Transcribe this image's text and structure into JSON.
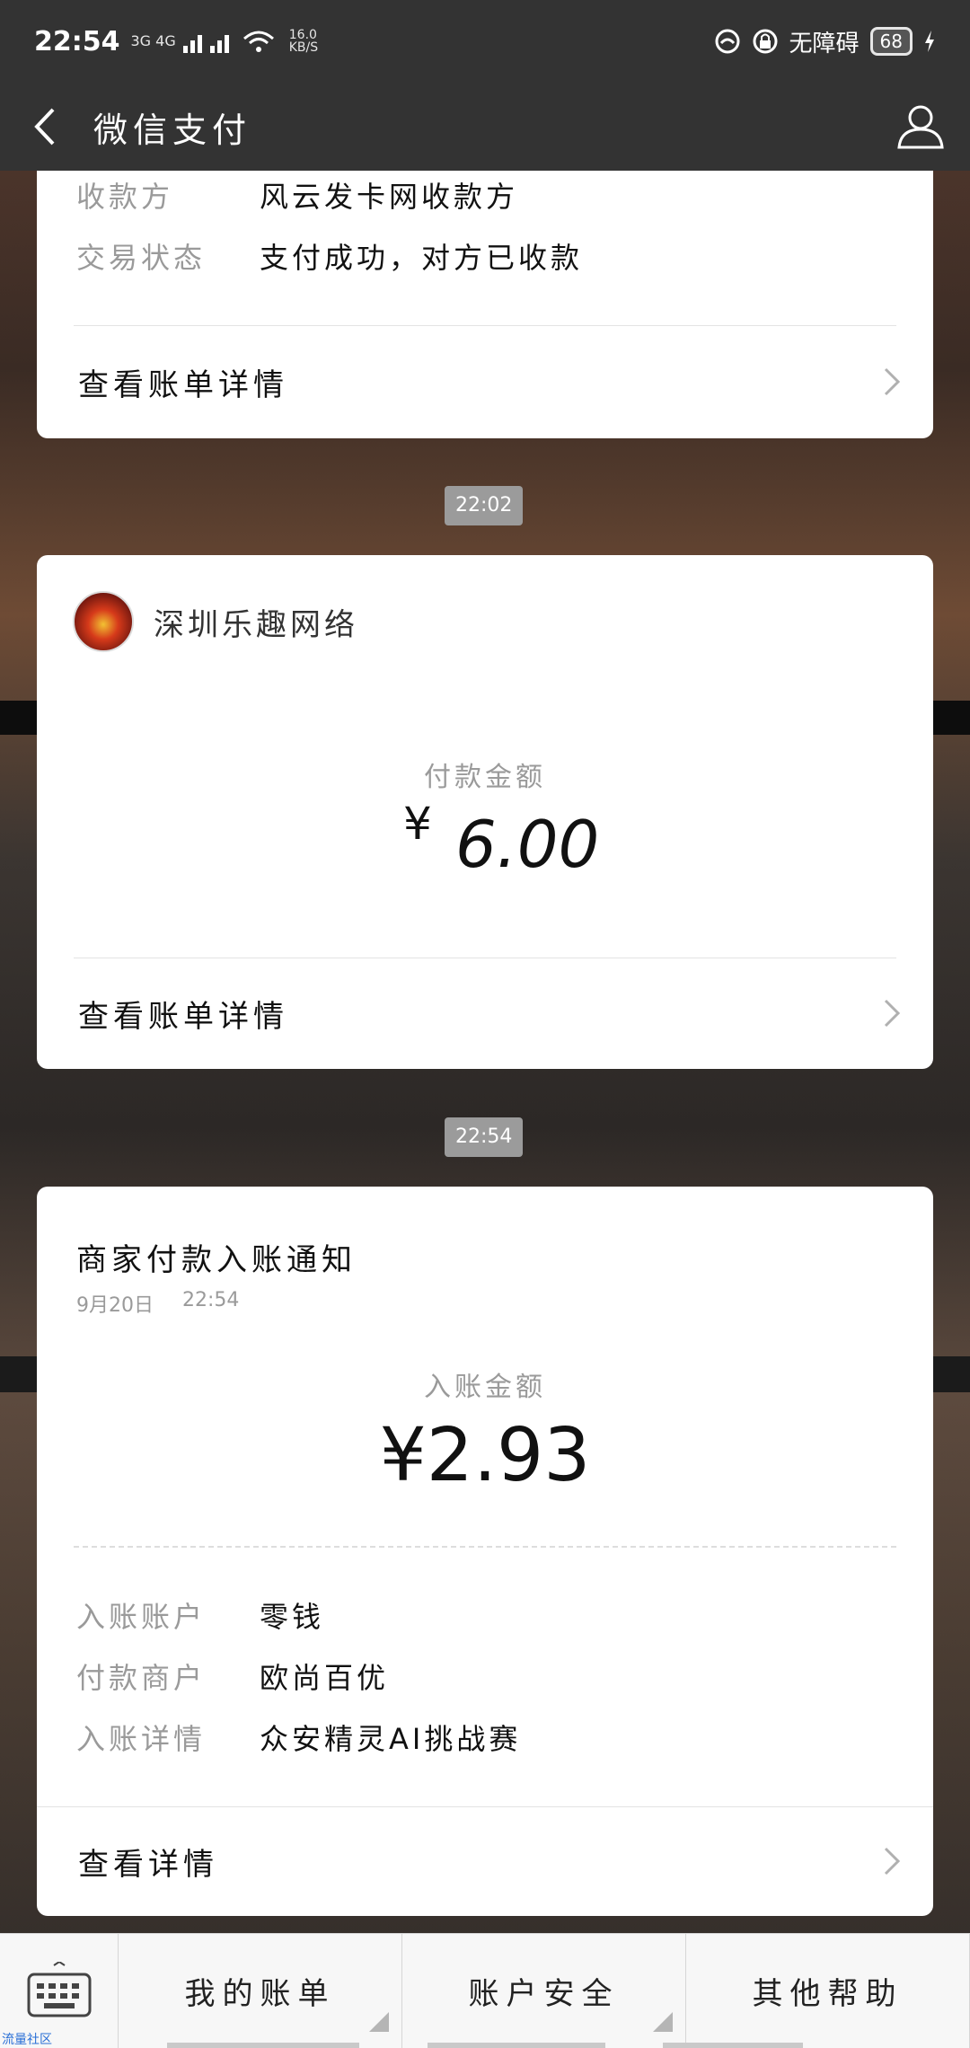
{
  "status_bar": {
    "time": "22:54",
    "network": "3G 4G",
    "speed": "16.0 KB/S",
    "dnd_label": "无障碍",
    "battery": "68"
  },
  "nav": {
    "title": "微信支付"
  },
  "card1": {
    "rows": [
      {
        "key": "收款方",
        "value": "风云发卡网收款方"
      },
      {
        "key": "交易状态",
        "value": "支付成功，对方已收款"
      }
    ],
    "link": "查看账单详情"
  },
  "time1": "22:02",
  "card2": {
    "merchant": "深圳乐趣网络",
    "amount_label": "付款金额",
    "currency": "¥",
    "amount": "6.00",
    "link": "查看账单详情"
  },
  "time2": "22:54",
  "card3": {
    "title": "商家付款入账通知",
    "date": "9月20日",
    "time": "22:54",
    "amount_label": "入账金额",
    "amount": "¥2.93",
    "rows": [
      {
        "key": "入账账户",
        "value": "零钱"
      },
      {
        "key": "付款商户",
        "value": "欧尚百优"
      },
      {
        "key": "入账详情",
        "value": "众安精灵AI挑战赛"
      }
    ],
    "link": "查看详情"
  },
  "bottom_menu": {
    "items": [
      "我的账单",
      "账户安全",
      "其他帮助"
    ]
  },
  "watermark": "流量社区"
}
